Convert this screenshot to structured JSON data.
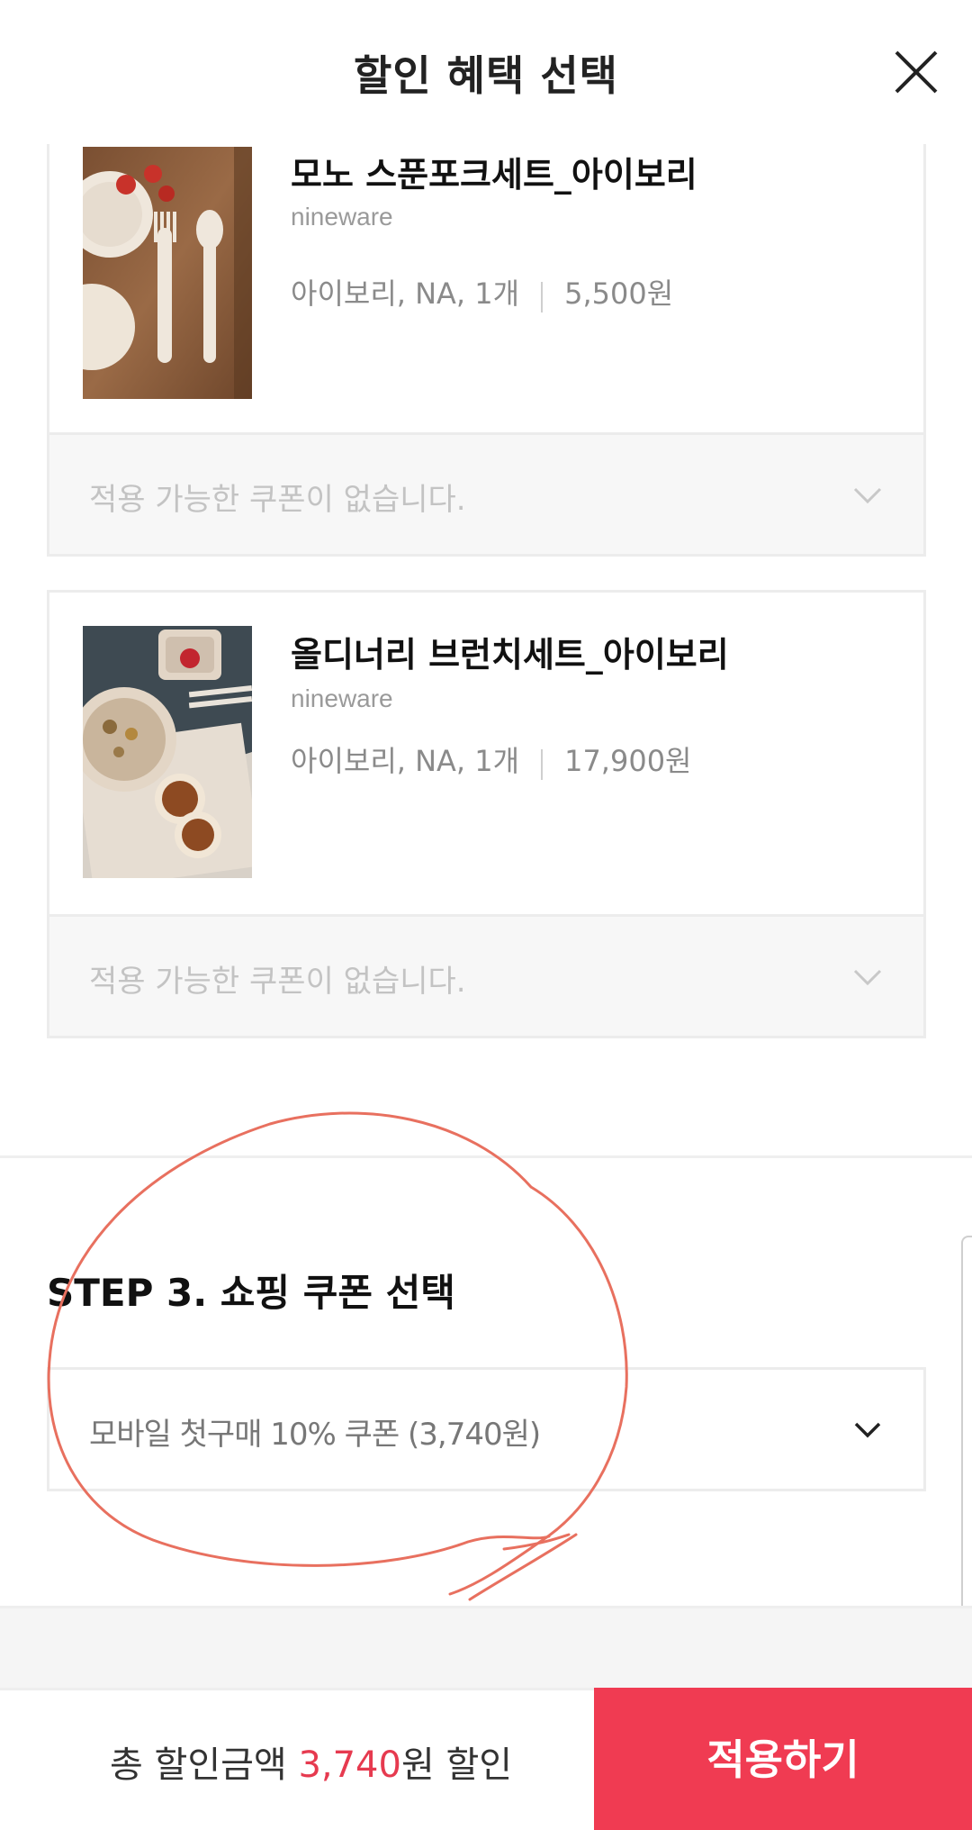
{
  "header": {
    "title": "할인 혜택 선택"
  },
  "products": [
    {
      "name": "모노 스푼포크세트_아이보리",
      "brand": "nineware",
      "option": "아이보리, NA, 1개",
      "price": "5,500원",
      "coupon_text": "적용 가능한 쿠폰이 없습니다."
    },
    {
      "name": "올디너리 브런치세트_아이보리",
      "brand": "nineware",
      "option": "아이보리, NA, 1개",
      "price": "17,900원",
      "coupon_text": "적용 가능한 쿠폰이 없습니다."
    }
  ],
  "step3": {
    "title": "STEP 3. 쇼핑 쿠폰 선택",
    "selected_coupon": "모바일 첫구매 10% 쿠폰 (3,740원)"
  },
  "footer": {
    "total_prefix": "총 할인금액 ",
    "total_amount": "3,740",
    "total_suffix": "원 할인",
    "apply_label": "적용하기"
  },
  "colors": {
    "accent": "#f03b52",
    "amount": "#e63a4f",
    "annotation": "#e8705f"
  }
}
